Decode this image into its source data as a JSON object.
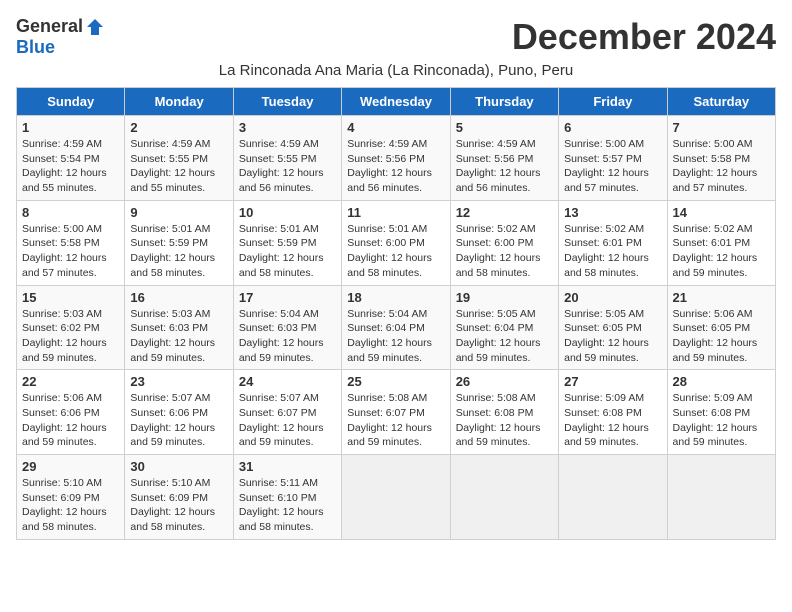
{
  "logo": {
    "general": "General",
    "blue": "Blue"
  },
  "title": "December 2024",
  "location": "La Rinconada Ana Maria (La Rinconada), Puno, Peru",
  "days_of_week": [
    "Sunday",
    "Monday",
    "Tuesday",
    "Wednesday",
    "Thursday",
    "Friday",
    "Saturday"
  ],
  "weeks": [
    [
      {
        "day": "1",
        "text": "Sunrise: 4:59 AM\nSunset: 5:54 PM\nDaylight: 12 hours and 55 minutes."
      },
      {
        "day": "2",
        "text": "Sunrise: 4:59 AM\nSunset: 5:55 PM\nDaylight: 12 hours and 55 minutes."
      },
      {
        "day": "3",
        "text": "Sunrise: 4:59 AM\nSunset: 5:55 PM\nDaylight: 12 hours and 56 minutes."
      },
      {
        "day": "4",
        "text": "Sunrise: 4:59 AM\nSunset: 5:56 PM\nDaylight: 12 hours and 56 minutes."
      },
      {
        "day": "5",
        "text": "Sunrise: 4:59 AM\nSunset: 5:56 PM\nDaylight: 12 hours and 56 minutes."
      },
      {
        "day": "6",
        "text": "Sunrise: 5:00 AM\nSunset: 5:57 PM\nDaylight: 12 hours and 57 minutes."
      },
      {
        "day": "7",
        "text": "Sunrise: 5:00 AM\nSunset: 5:58 PM\nDaylight: 12 hours and 57 minutes."
      }
    ],
    [
      {
        "day": "8",
        "text": "Sunrise: 5:00 AM\nSunset: 5:58 PM\nDaylight: 12 hours and 57 minutes."
      },
      {
        "day": "9",
        "text": "Sunrise: 5:01 AM\nSunset: 5:59 PM\nDaylight: 12 hours and 58 minutes."
      },
      {
        "day": "10",
        "text": "Sunrise: 5:01 AM\nSunset: 5:59 PM\nDaylight: 12 hours and 58 minutes."
      },
      {
        "day": "11",
        "text": "Sunrise: 5:01 AM\nSunset: 6:00 PM\nDaylight: 12 hours and 58 minutes."
      },
      {
        "day": "12",
        "text": "Sunrise: 5:02 AM\nSunset: 6:00 PM\nDaylight: 12 hours and 58 minutes."
      },
      {
        "day": "13",
        "text": "Sunrise: 5:02 AM\nSunset: 6:01 PM\nDaylight: 12 hours and 58 minutes."
      },
      {
        "day": "14",
        "text": "Sunrise: 5:02 AM\nSunset: 6:01 PM\nDaylight: 12 hours and 59 minutes."
      }
    ],
    [
      {
        "day": "15",
        "text": "Sunrise: 5:03 AM\nSunset: 6:02 PM\nDaylight: 12 hours and 59 minutes."
      },
      {
        "day": "16",
        "text": "Sunrise: 5:03 AM\nSunset: 6:03 PM\nDaylight: 12 hours and 59 minutes."
      },
      {
        "day": "17",
        "text": "Sunrise: 5:04 AM\nSunset: 6:03 PM\nDaylight: 12 hours and 59 minutes."
      },
      {
        "day": "18",
        "text": "Sunrise: 5:04 AM\nSunset: 6:04 PM\nDaylight: 12 hours and 59 minutes."
      },
      {
        "day": "19",
        "text": "Sunrise: 5:05 AM\nSunset: 6:04 PM\nDaylight: 12 hours and 59 minutes."
      },
      {
        "day": "20",
        "text": "Sunrise: 5:05 AM\nSunset: 6:05 PM\nDaylight: 12 hours and 59 minutes."
      },
      {
        "day": "21",
        "text": "Sunrise: 5:06 AM\nSunset: 6:05 PM\nDaylight: 12 hours and 59 minutes."
      }
    ],
    [
      {
        "day": "22",
        "text": "Sunrise: 5:06 AM\nSunset: 6:06 PM\nDaylight: 12 hours and 59 minutes."
      },
      {
        "day": "23",
        "text": "Sunrise: 5:07 AM\nSunset: 6:06 PM\nDaylight: 12 hours and 59 minutes."
      },
      {
        "day": "24",
        "text": "Sunrise: 5:07 AM\nSunset: 6:07 PM\nDaylight: 12 hours and 59 minutes."
      },
      {
        "day": "25",
        "text": "Sunrise: 5:08 AM\nSunset: 6:07 PM\nDaylight: 12 hours and 59 minutes."
      },
      {
        "day": "26",
        "text": "Sunrise: 5:08 AM\nSunset: 6:08 PM\nDaylight: 12 hours and 59 minutes."
      },
      {
        "day": "27",
        "text": "Sunrise: 5:09 AM\nSunset: 6:08 PM\nDaylight: 12 hours and 59 minutes."
      },
      {
        "day": "28",
        "text": "Sunrise: 5:09 AM\nSunset: 6:08 PM\nDaylight: 12 hours and 59 minutes."
      }
    ],
    [
      {
        "day": "29",
        "text": "Sunrise: 5:10 AM\nSunset: 6:09 PM\nDaylight: 12 hours and 58 minutes."
      },
      {
        "day": "30",
        "text": "Sunrise: 5:10 AM\nSunset: 6:09 PM\nDaylight: 12 hours and 58 minutes."
      },
      {
        "day": "31",
        "text": "Sunrise: 5:11 AM\nSunset: 6:10 PM\nDaylight: 12 hours and 58 minutes."
      },
      {
        "day": "",
        "text": ""
      },
      {
        "day": "",
        "text": ""
      },
      {
        "day": "",
        "text": ""
      },
      {
        "day": "",
        "text": ""
      }
    ]
  ]
}
